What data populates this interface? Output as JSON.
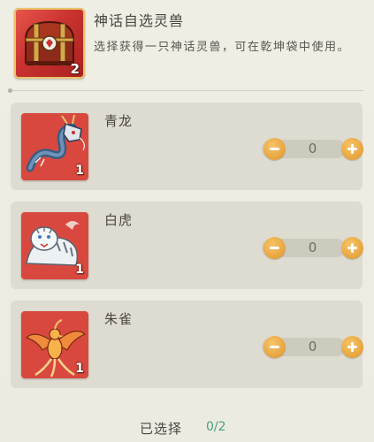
{
  "reward": {
    "title": "神话自选灵兽",
    "description": "选择获得一只神话灵兽，可在乾坤袋中使用。",
    "count": "2",
    "icon": "treasure-chest-icon"
  },
  "beasts": [
    {
      "name": "青龙",
      "count": "1",
      "value": "0",
      "icon": "azure-dragon-icon"
    },
    {
      "name": "白虎",
      "count": "1",
      "value": "0",
      "icon": "white-tiger-icon"
    },
    {
      "name": "朱雀",
      "count": "1",
      "value": "0",
      "icon": "vermilion-bird-icon"
    }
  ],
  "footer": {
    "selected_label": "已选择",
    "selected_count": "0/2"
  },
  "colors": {
    "accent_orange": "#e7a33d",
    "card_red": "#c9322f",
    "frame_gold": "#e9c36a",
    "count_green": "#4aa07a"
  }
}
